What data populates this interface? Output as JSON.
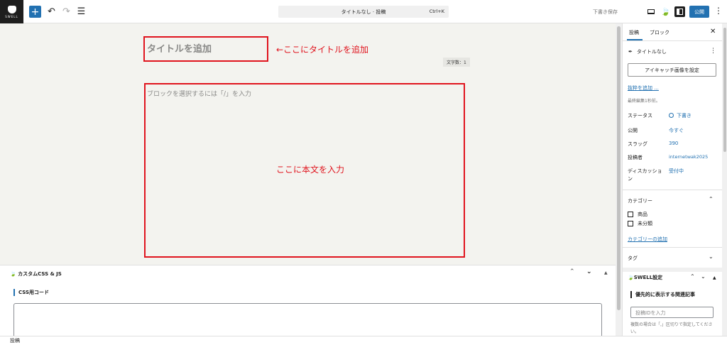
{
  "topbar": {
    "logo_text": "SWELL",
    "add_icon": "plus-icon",
    "undo_icon": "undo-icon",
    "redo_icon": "redo-icon",
    "list_icon": "list-view-icon",
    "command_title": "タイトルなし · 投稿",
    "command_shortcut": "Ctrl+K",
    "save_draft": "下書き保存",
    "publish": "公開"
  },
  "editor": {
    "title_placeholder": "タイトルを追加",
    "title_annotation": "←ここにタイトルを追加",
    "word_count": "文字数：1",
    "body_placeholder": "ブロックを選択するには「/」を入力",
    "body_annotation": "ここに本文を入力"
  },
  "metabox": {
    "title": "カスタムCSS & JS",
    "css_label": "CSS用コード"
  },
  "sidebar": {
    "tabs": [
      "投稿",
      "ブロック"
    ],
    "post_title": "タイトルなし",
    "featured_button": "アイキャッチ画像を設定",
    "excerpt_link": "抜粋を追加 ...",
    "last_edited": "最終編集1秒前。",
    "fields": [
      {
        "label": "ステータス",
        "value": "下書き"
      },
      {
        "label": "公開",
        "value": "今すぐ"
      },
      {
        "label": "スラッグ",
        "value": "390"
      },
      {
        "label": "投稿者",
        "value": "internetwak2025"
      },
      {
        "label": "ディスカッション",
        "value": "受付中"
      }
    ],
    "category_title": "カテゴリー",
    "categories": [
      "商品",
      "未分類"
    ],
    "add_category": "カテゴリーの追加",
    "tag_title": "タグ",
    "swell_title": "SWELL設定",
    "related_label": "優先的に表示する関連記事",
    "related_placeholder": "投稿IDを入力",
    "related_help": "複数の場合は「,」区切りで指定してください。"
  },
  "footer": {
    "breadcrumb": "投稿"
  },
  "colors": {
    "accent": "#2271b1",
    "annotation_red": "#e0141e",
    "canvas_bg": "#f3f3ef"
  }
}
